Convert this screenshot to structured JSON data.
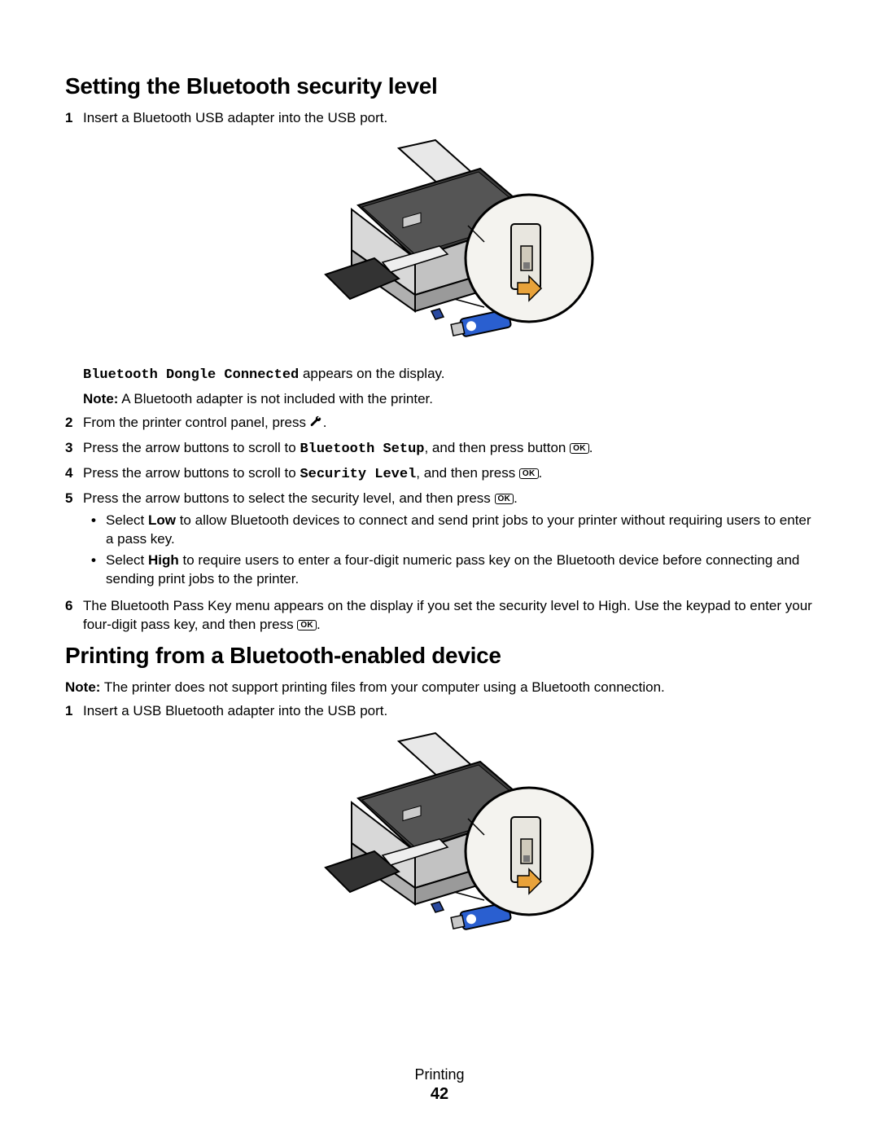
{
  "section1": {
    "heading": "Setting the Bluetooth security level",
    "step1": "Insert a Bluetooth USB adapter into the USB port.",
    "dongle_msg_mono": "Bluetooth Dongle Connected",
    "dongle_msg_rest": " appears on the display.",
    "note_label": "Note:",
    "note_text": " A Bluetooth adapter is not included with the printer.",
    "step2": "From the printer control panel, press ",
    "step3_a": "Press the arrow buttons to scroll to ",
    "step3_mono": "Bluetooth Setup",
    "step3_b": ", and then press button ",
    "step4_a": "Press the arrow buttons to scroll to ",
    "step4_mono": "Security Level",
    "step4_b": ", and then press ",
    "step5": "Press the arrow buttons to select the security level, and then press ",
    "bullet_low_a": "Select ",
    "bullet_low_bold": "Low",
    "bullet_low_b": " to allow Bluetooth devices to connect and send print jobs to your printer without requiring users to enter a pass key.",
    "bullet_high_a": "Select ",
    "bullet_high_bold": "High",
    "bullet_high_b": " to require users to enter a four-digit numeric pass key on the Bluetooth device before connecting and sending print jobs to the printer.",
    "step6_a": "The Bluetooth Pass Key menu appears on the display if you set the security level to High. Use the keypad to enter your four-digit pass key, and then press "
  },
  "section2": {
    "heading": "Printing from a Bluetooth-enabled device",
    "note_label": "Note:",
    "note_text": " The printer does not support printing files from your computer using a Bluetooth connection.",
    "step1": "Insert a USB Bluetooth adapter into the USB port."
  },
  "footer": {
    "section": "Printing",
    "page": "42"
  },
  "ok_label": "OK"
}
